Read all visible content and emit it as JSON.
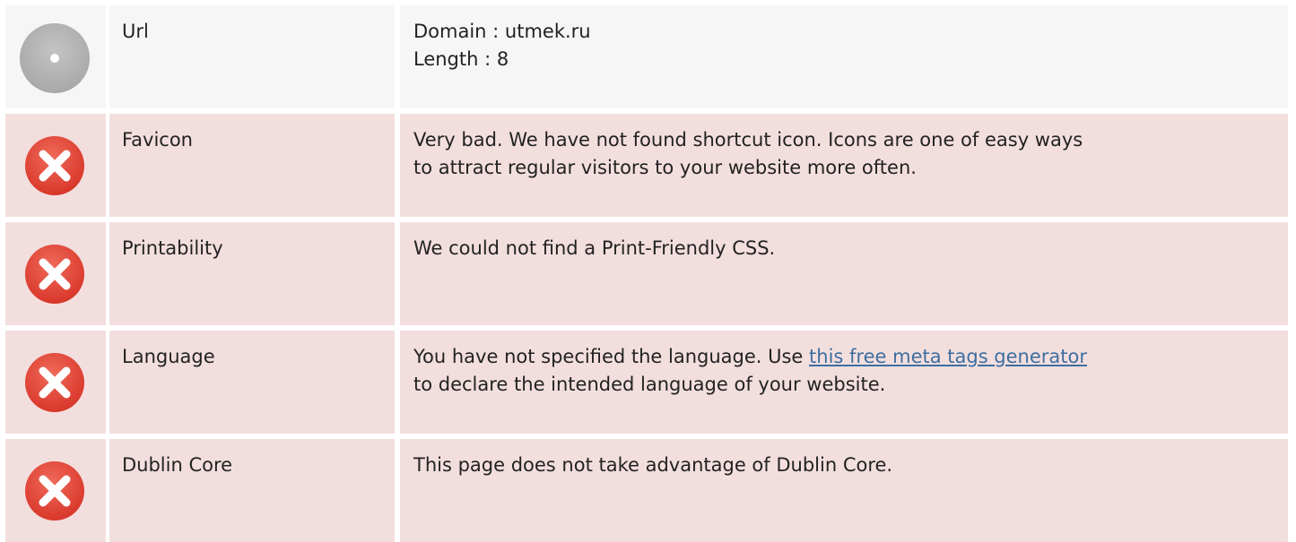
{
  "rows": [
    {
      "status": "neutral",
      "icon": "neutral-disc-icon",
      "label": "Url",
      "lines": [
        "Domain : utmek.ru",
        "Length : 8"
      ]
    },
    {
      "status": "fail",
      "icon": "error-x-icon",
      "label": "Favicon",
      "lines": [
        "Very bad. We have not found shortcut icon. Icons are one of easy ways",
        "to attract regular visitors to your website more often."
      ]
    },
    {
      "status": "fail",
      "icon": "error-x-icon",
      "label": "Printability",
      "lines": [
        "We could not find a Print-Friendly CSS."
      ]
    },
    {
      "status": "fail",
      "icon": "error-x-icon",
      "label": "Language",
      "text_before_link": "You have not specified the language. Use ",
      "link_text": "this free meta tags generator",
      "text_after_link": "to declare the intended language of your website."
    },
    {
      "status": "fail",
      "icon": "error-x-icon",
      "label": "Dublin Core",
      "lines": [
        "This page does not take advantage of Dublin Core."
      ]
    }
  ],
  "colors": {
    "neutral_row_bg": "#f6f6f6",
    "fail_row_bg": "#f3dede",
    "error_icon_red": "#e74c3c",
    "link": "#3d6fa0"
  }
}
